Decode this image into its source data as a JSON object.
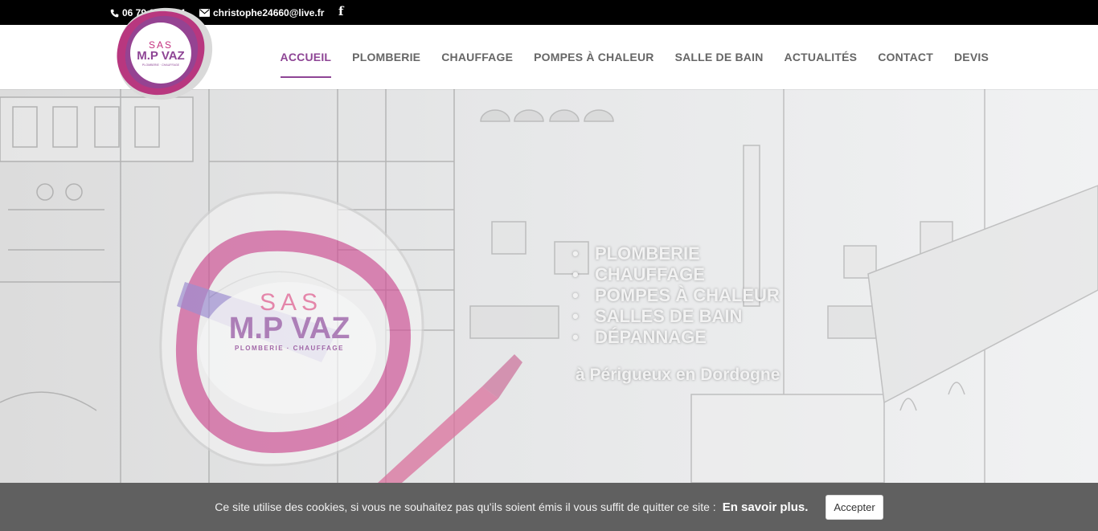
{
  "topbar": {
    "phone": "06 79 65 00 11",
    "email": "christophe24660@live.fr",
    "phone_icon": "phone-icon",
    "email_icon": "envelope-icon",
    "social_icon": "facebook-icon",
    "social_label": "f"
  },
  "logo": {
    "line1": "SAS",
    "line2": "M.P VAZ",
    "line3": "PLOMBERIE · CHAUFFAGE",
    "colors": [
      "#c4307f",
      "#8e4595",
      "#e6e6e6"
    ]
  },
  "nav": {
    "items": [
      {
        "label": "ACCUEIL",
        "active": true
      },
      {
        "label": "PLOMBERIE"
      },
      {
        "label": "CHAUFFAGE"
      },
      {
        "label": "POMPES À CHALEUR"
      },
      {
        "label": "SALLE DE BAIN"
      },
      {
        "label": "ACTUALITÉS"
      },
      {
        "label": "CONTACT"
      },
      {
        "label": "DEVIS"
      }
    ],
    "active_color": "#8e4595"
  },
  "hero": {
    "services": [
      "PLOMBERIE",
      "CHAUFFAGE",
      "POMPES À CHALEUR",
      "SALLES DE BAIN",
      "DÉPANNAGE"
    ],
    "location": "à Périgueux en Dordogne",
    "logo_sas": "SAS",
    "logo_name": "M.P VAZ",
    "logo_tagline": "PLOMBERIE · CHAUFFAGE"
  },
  "cookie": {
    "text": "Ce site utilise des cookies, si vous ne souhaitez pas qu'ils soient émis il vous suffit de quitter ce site :",
    "more": "En savoir plus.",
    "accept": "Accepter"
  }
}
